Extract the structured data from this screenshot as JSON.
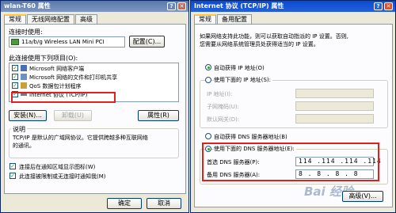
{
  "left_window": {
    "title": "wlan-T60 属性",
    "tabs": [
      "常规",
      "无线网络配置",
      "高级"
    ],
    "connect_using_label": "连接时使用:",
    "adapter": "11a/b/g Wireless LAN Mini PCI",
    "configure_button": "配置(C)...",
    "items_label": "此连接使用下列项目(O):",
    "items": [
      {
        "label": "Microsoft 网络客户端",
        "checked": true
      },
      {
        "label": "Microsoft 网络的文件和打印机共享",
        "checked": true
      },
      {
        "label": "QoS 数据包计划程序",
        "checked": true
      },
      {
        "label": "Internet 协议 (TCP/IP)",
        "checked": true
      }
    ],
    "install_button": "安装(N)...",
    "uninstall_button": "卸载(U)",
    "properties_button": "属性(R)",
    "description_title": "说明",
    "description_text": [
      "TCP/IP 是默认的广域网协议。它提供跨越多种互联网络",
      "的通讯。"
    ],
    "show_icon_label": "连接后在通知区域显示图标(W)",
    "notify_label": "此连接被限制或无连接时通知我(M)",
    "ok_button": "确定",
    "cancel_button": "取消"
  },
  "right_window": {
    "title": "Internet 协议 (TCP/IP) 属性",
    "tabs": [
      "常规",
      "备用配置"
    ],
    "intro": [
      "如果网络支持此功能，则可以获取自动指派的 IP 设置。否则,",
      "您需要从网络系统管理员处获得适当的 IP 设置。"
    ],
    "auto_ip_label": "自动获得 IP 地址(O)",
    "manual_ip_label": "使用下面的 IP 地址(S):",
    "ip_address_label": "IP 地址(I):",
    "subnet_label": "子网掩码(U):",
    "gateway_label": "默认网关(D):",
    "auto_dns_label": "自动获得 DNS 服务器地址(B)",
    "manual_dns_label": "使用下面的 DNS 服务器地址(E):",
    "preferred_dns_label": "首选 DNS 服务器(P):",
    "preferred_dns_value": "114 .114 .114 .114",
    "alternate_dns_label": "备用 DNS 服务器(A):",
    "alternate_dns_value": "8 . 8 . 8 . 8",
    "advanced_button": "高级(V)...",
    "selected": {
      "ip": "auto",
      "dns": "manual"
    }
  },
  "watermark": "Bai 经验",
  "colors": {
    "title_blue": "#0a246a",
    "highlight_red": "#e0201c",
    "window_bg": "#ece9d8"
  }
}
